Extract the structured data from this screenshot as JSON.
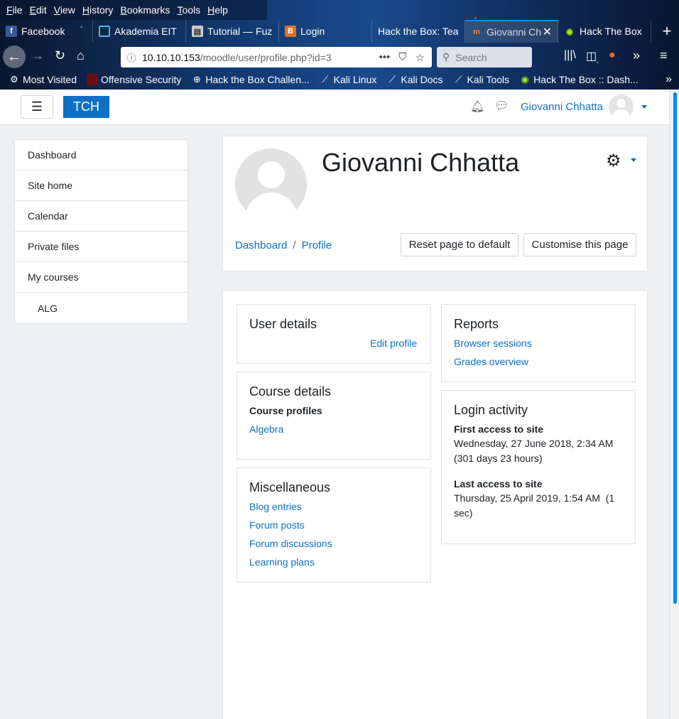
{
  "browser": {
    "menu": [
      "File",
      "Edit",
      "View",
      "History",
      "Bookmarks",
      "Tools",
      "Help"
    ],
    "tabs": [
      {
        "label": "Facebook",
        "icon": "facebook-icon",
        "active": false
      },
      {
        "label": "Akademia EIT",
        "icon": "grid-icon",
        "active": false
      },
      {
        "label": "Tutorial — Fuz",
        "icon": "book-icon",
        "active": false
      },
      {
        "label": "Login",
        "icon": "shield-icon",
        "active": false
      },
      {
        "label": "Hack the Box: Tea",
        "icon": "",
        "active": false
      },
      {
        "label": "Giovanni Ch",
        "icon": "moodle-icon",
        "active": true
      },
      {
        "label": "Hack The Box",
        "icon": "cube-icon",
        "active": false
      }
    ],
    "url_host": "10.10.10.153",
    "url_path": "/moodle/user/profile.php?id=3",
    "search_placeholder": "Search",
    "bookmarks": [
      {
        "label": "Most Visited",
        "icon": "gear-icon"
      },
      {
        "label": "Offensive Security",
        "icon": "offsec-icon"
      },
      {
        "label": "Hack the Box Challen...",
        "icon": "globe-icon"
      },
      {
        "label": "Kali Linux",
        "icon": "kali-icon"
      },
      {
        "label": "Kali Docs",
        "icon": "kali-icon"
      },
      {
        "label": "Kali Tools",
        "icon": "kali-icon"
      },
      {
        "label": "Hack The Box :: Dash...",
        "icon": "cube-icon"
      }
    ]
  },
  "topnav": {
    "brand": "TCH",
    "username": "Giovanni Chhatta"
  },
  "sidebar": {
    "items": [
      {
        "label": "Dashboard"
      },
      {
        "label": "Site home"
      },
      {
        "label": "Calendar"
      },
      {
        "label": "Private files"
      },
      {
        "label": "My courses"
      },
      {
        "label": "ALG"
      }
    ]
  },
  "profile": {
    "fullname": "Giovanni Chhatta",
    "breadcrumb": [
      "Dashboard",
      "Profile"
    ],
    "reset_button": "Reset page to default",
    "customise_button": "Customise this page"
  },
  "blocks": {
    "user_details": {
      "title": "User details",
      "edit_link": "Edit profile"
    },
    "course_details": {
      "title": "Course details",
      "subtitle": "Course profiles",
      "course": "Algebra"
    },
    "misc": {
      "title": "Miscellaneous",
      "links": [
        "Blog entries",
        "Forum posts",
        "Forum discussions",
        "Learning plans"
      ]
    },
    "reports": {
      "title": "Reports",
      "links": [
        "Browser sessions",
        "Grades overview"
      ]
    },
    "login": {
      "title": "Login activity",
      "first_label": "First access to site",
      "first_line1": "Wednesday, 27 June 2018, 2:34 AM",
      "first_line2": "(301 days 23 hours)",
      "last_label": "Last access to site",
      "last_line1": "Thursday, 25 April 2019, 1:54 AM  (1",
      "last_line2": "sec)"
    }
  },
  "colors": {
    "accent": "#0f6fc5",
    "browser_focus": "#0a84ff",
    "page_bg": "#eef0f2"
  }
}
